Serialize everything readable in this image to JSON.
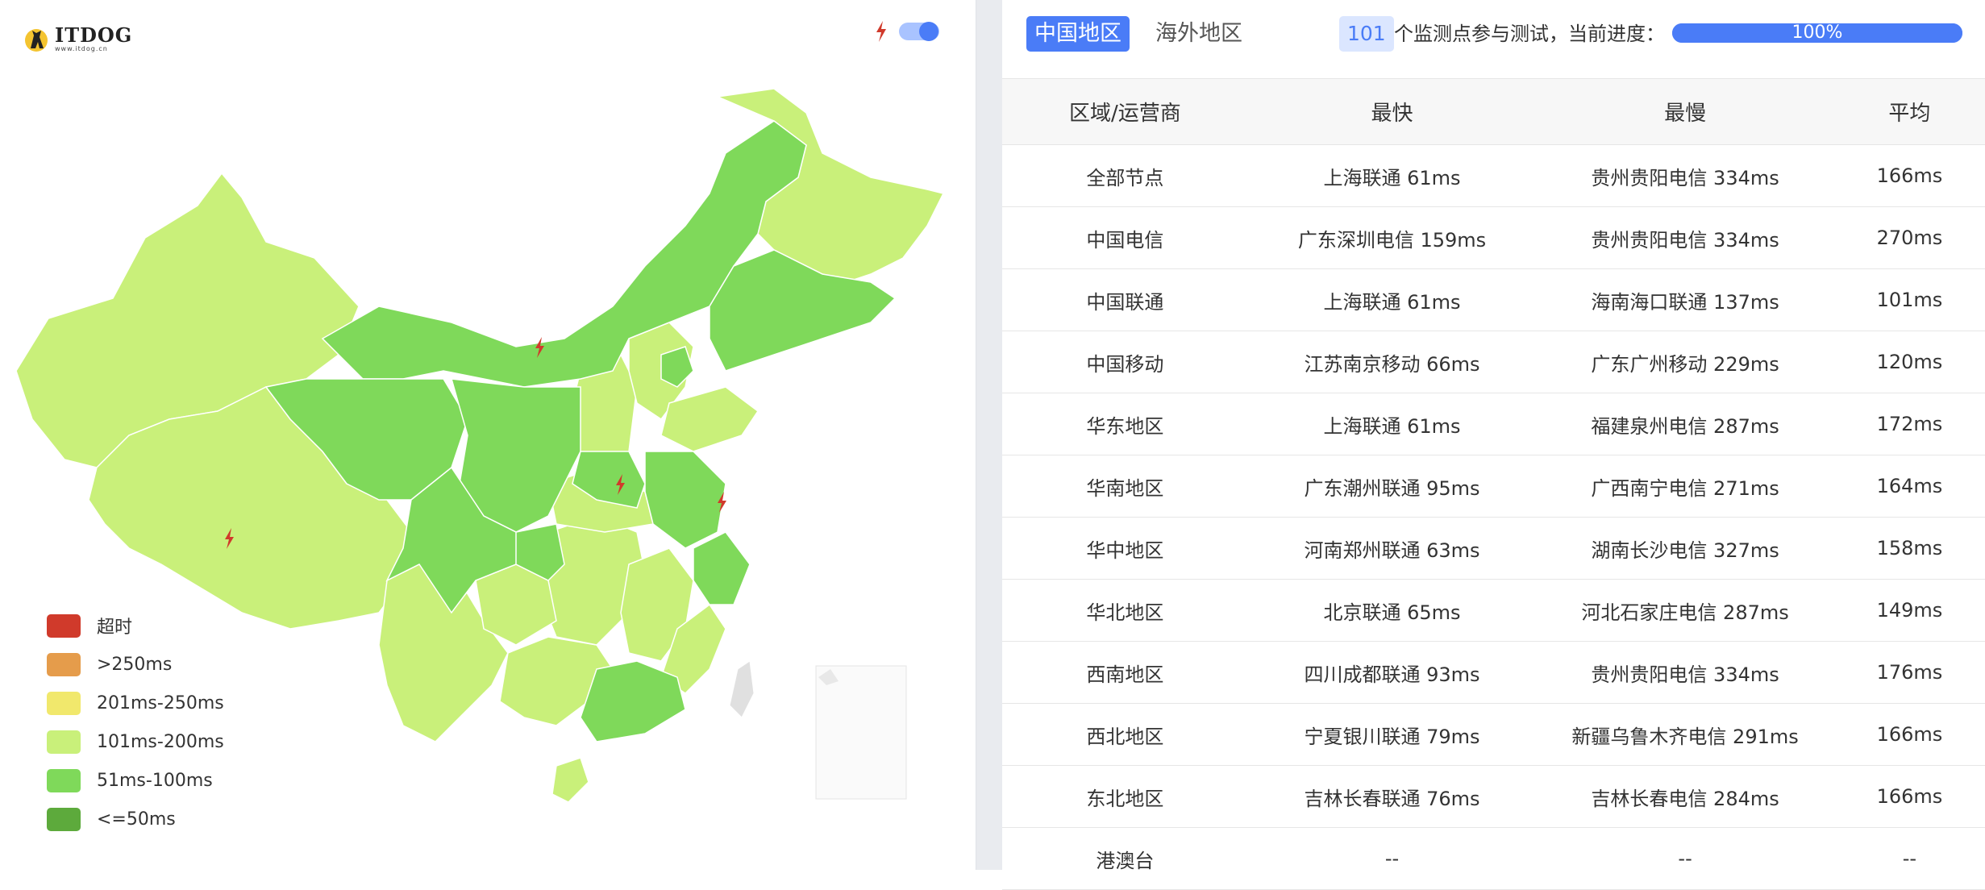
{
  "brand": {
    "name": "ITDOG",
    "domain": "www.itdog.cn"
  },
  "legend": [
    {
      "label": "超时",
      "color": "#d03a2b"
    },
    {
      "label": ">250ms",
      "color": "#e59c4b"
    },
    {
      "label": "201ms-250ms",
      "color": "#f1e86c"
    },
    {
      "label": "101ms-200ms",
      "color": "#c9f07a"
    },
    {
      "label": "51ms-100ms",
      "color": "#7fd95a"
    },
    {
      "label": "<=50ms",
      "color": "#5daa3c"
    }
  ],
  "tabs": {
    "china": "中国地区",
    "overseas": "海外地区"
  },
  "probe": {
    "count": "101",
    "text": "个监测点参与测试，当前进度：",
    "progress": "100%",
    "progress_fraction": 1.0
  },
  "table": {
    "headers": [
      "区域/运营商",
      "最快",
      "最慢",
      "平均"
    ],
    "rows": [
      [
        "全部节点",
        "上海联通 61ms",
        "贵州贵阳电信 334ms",
        "166ms"
      ],
      [
        "中国电信",
        "广东深圳电信 159ms",
        "贵州贵阳电信 334ms",
        "270ms"
      ],
      [
        "中国联通",
        "上海联通 61ms",
        "海南海口联通 137ms",
        "101ms"
      ],
      [
        "中国移动",
        "江苏南京移动 66ms",
        "广东广州移动 229ms",
        "120ms"
      ],
      [
        "华东地区",
        "上海联通 61ms",
        "福建泉州电信 287ms",
        "172ms"
      ],
      [
        "华南地区",
        "广东潮州联通 95ms",
        "广西南宁电信 271ms",
        "164ms"
      ],
      [
        "华中地区",
        "河南郑州联通 63ms",
        "湖南长沙电信 327ms",
        "158ms"
      ],
      [
        "华北地区",
        "北京联通 65ms",
        "河北石家庄电信 287ms",
        "149ms"
      ],
      [
        "西南地区",
        "四川成都联通 93ms",
        "贵州贵阳电信 334ms",
        "176ms"
      ],
      [
        "西北地区",
        "宁夏银川联通 79ms",
        "新疆乌鲁木齐电信 291ms",
        "166ms"
      ],
      [
        "东北地区",
        "吉林长春联通 76ms",
        "吉林长春电信 284ms",
        "166ms"
      ],
      [
        "港澳台",
        "--",
        "--",
        "--"
      ]
    ]
  },
  "colors": {
    "accent": "#4a7cf7",
    "light_green": "#c9f07a",
    "green": "#7fd95a",
    "bolt": "#d03a2b"
  }
}
